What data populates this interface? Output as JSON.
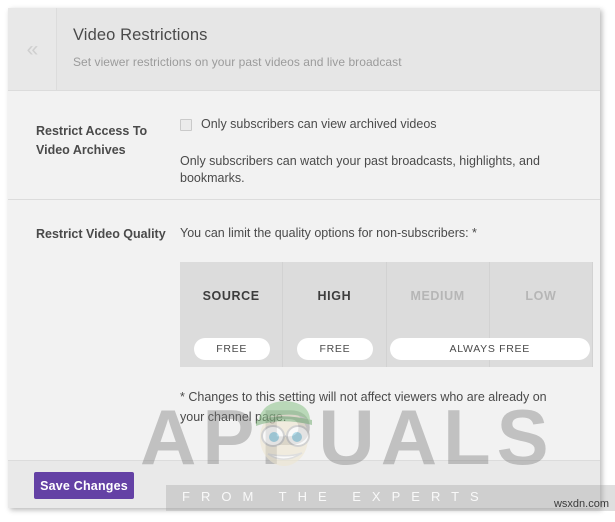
{
  "panel": {
    "collapse_icon": "chevrons-left-icon",
    "header": {
      "title": "Video Restrictions",
      "subtitle": "Set viewer restrictions on your past videos and live broadcast"
    }
  },
  "sections": {
    "archives": {
      "label": "Restrict Access To Video Archives",
      "checkbox_label": "Only subscribers can view archived videos",
      "checkbox_checked": false,
      "help_text": "Only subscribers can watch your past broadcasts, highlights, and bookmarks."
    },
    "quality": {
      "label": "Restrict Video Quality",
      "intro": "You can limit the quality options for non-subscribers: *",
      "footnote": "* Changes to this setting will not affect viewers who are already on your channel page.",
      "columns": [
        {
          "name": "SOURCE",
          "dimmed": false,
          "pill": "FREE",
          "span": 1
        },
        {
          "name": "HIGH",
          "dimmed": false,
          "pill": "FREE",
          "span": 1
        },
        {
          "name": "MEDIUM",
          "dimmed": true,
          "pill": null,
          "span": 1
        },
        {
          "name": "LOW",
          "dimmed": true,
          "pill": null,
          "span": 1
        }
      ],
      "wide_pill": "ALWAYS FREE"
    }
  },
  "footer": {
    "save_label": "Save Changes"
  },
  "watermark": {
    "word": "APPUALS",
    "tagline": "FROM THE EXPERTS",
    "site": "wsxdn.com"
  },
  "colors": {
    "brand_purple": "#6441a5",
    "header_band": "#e6e6e6",
    "body_bg": "#f2f2f2",
    "table_bg": "#dcdcdc",
    "text": "#4a4a4a",
    "muted": "#b6b6b6"
  }
}
